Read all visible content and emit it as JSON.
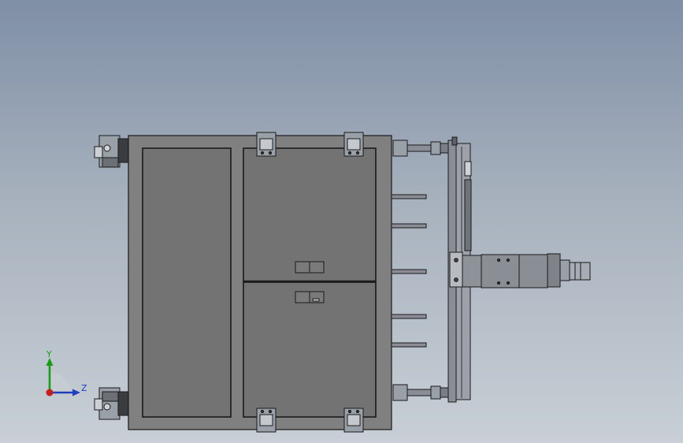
{
  "viewport": {
    "colors": {
      "background_top": "#7f8fa6",
      "background_bottom": "#c8cfd6",
      "panel_fill": "#737373",
      "panel_frame": "#808080",
      "edge": "#1a1a1a",
      "rail": "#8a8d95",
      "hardware": "#9aa0a8"
    }
  },
  "triad": {
    "y_label": "Y",
    "z_label": "Z",
    "colors": {
      "y": "#1a9b1a",
      "z": "#1f3fbf",
      "x": "#c41e1e",
      "arc": "#c8ccd2"
    }
  }
}
